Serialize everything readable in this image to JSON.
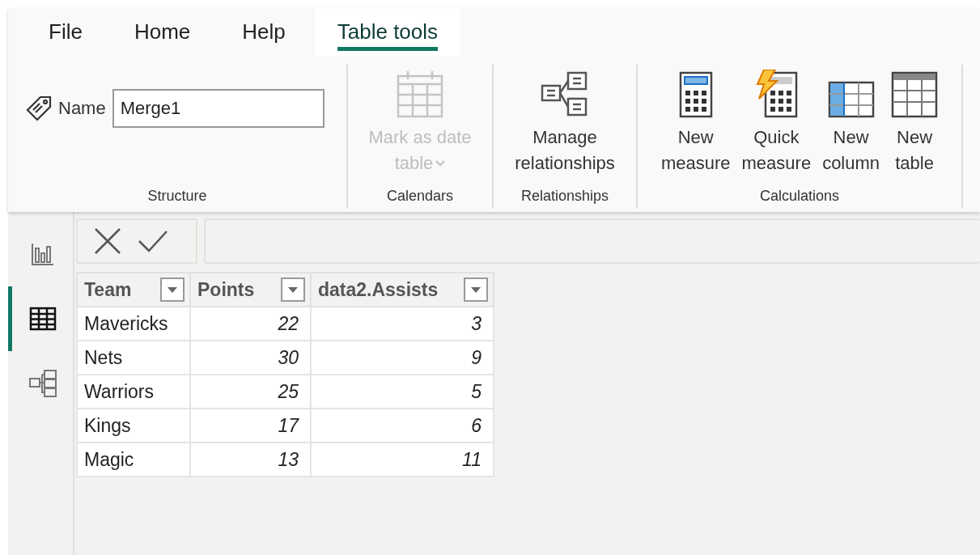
{
  "tabs": [
    {
      "label": "File",
      "selected": false
    },
    {
      "label": "Home",
      "selected": false
    },
    {
      "label": "Help",
      "selected": false
    },
    {
      "label": "Table tools",
      "selected": true
    }
  ],
  "ribbon": {
    "groups": [
      {
        "label": "Structure",
        "name_field": {
          "label": "Name",
          "value": "Merge1"
        }
      },
      {
        "label": "Calendars",
        "buttons": [
          {
            "kind": "calendar",
            "lines": [
              "Mark as date",
              "table"
            ],
            "disabled": true,
            "has_dropdown": true
          }
        ]
      },
      {
        "label": "Relationships",
        "buttons": [
          {
            "kind": "relationships",
            "lines": [
              "Manage",
              "relationships"
            ],
            "disabled": false,
            "has_dropdown": false
          }
        ]
      },
      {
        "label": "Calculations",
        "buttons": [
          {
            "kind": "measure",
            "lines": [
              "New",
              "measure"
            ],
            "disabled": false,
            "has_dropdown": false
          },
          {
            "kind": "quick_measure",
            "lines": [
              "Quick",
              "measure"
            ],
            "disabled": false,
            "has_dropdown": false
          },
          {
            "kind": "column",
            "lines": [
              "New",
              "column"
            ],
            "disabled": false,
            "has_dropdown": false
          },
          {
            "kind": "table",
            "lines": [
              "New",
              "table"
            ],
            "disabled": false,
            "has_dropdown": false
          }
        ]
      }
    ]
  },
  "sidebar": {
    "items": [
      {
        "kind": "report",
        "selected": false
      },
      {
        "kind": "data",
        "selected": true
      },
      {
        "kind": "model",
        "selected": false
      }
    ]
  },
  "table": {
    "columns": [
      "Team",
      "Points",
      "data2.Assists"
    ],
    "rows": [
      [
        "Mavericks",
        "22",
        "3"
      ],
      [
        "Nets",
        "30",
        "9"
      ],
      [
        "Warriors",
        "25",
        "5"
      ],
      [
        "Kings",
        "17",
        "6"
      ],
      [
        "Magic",
        "13",
        "11"
      ]
    ]
  }
}
